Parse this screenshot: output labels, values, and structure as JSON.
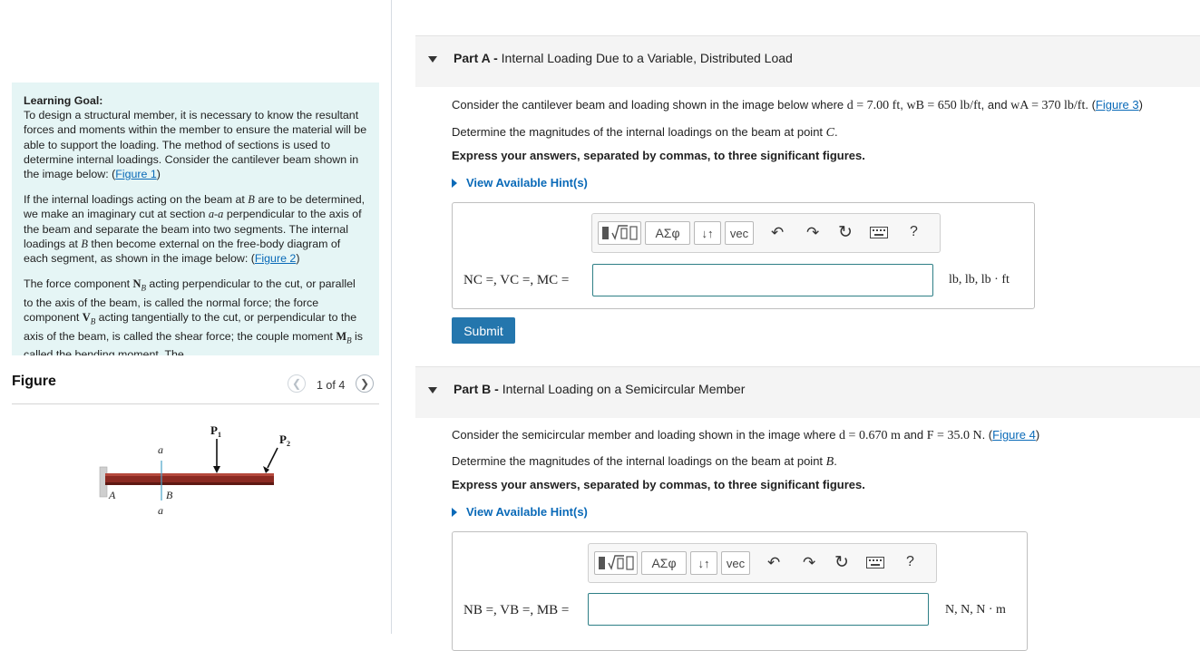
{
  "learning_goal": {
    "heading": "Learning Goal:",
    "p1_text": "To design a structural member, it is necessary to know the resultant forces and moments within the member to ensure the material will be able to support the loading. The method of sections is used to determine internal loadings. Consider the cantilever beam shown in the image below: (",
    "p1_link": "Figure 1",
    "p1_end": ")",
    "p2_a": "If the internal loadings acting on the beam at ",
    "p2_b_var": "B",
    "p2_c": " are to be determined, we make an imaginary cut at section ",
    "p2_d_var": "a-a",
    "p2_e": " perpendicular to the axis of the beam and separate the beam into two segments. The internal loadings at ",
    "p2_f_var": "B",
    "p2_g": " then become external on the free-body diagram of each segment, as shown in the image below: (",
    "p2_link": "Figure 2",
    "p2_end": ")",
    "p3_a": "The force component ",
    "p3_b_var": "N",
    "p3_b_sub": "B",
    "p3_c": " acting perpendicular to the cut, or parallel to the axis of the beam, is called the normal force; the force component ",
    "p3_d_var": "V",
    "p3_d_sub": "B",
    "p3_e": " acting tangentially to the cut, or perpendicular to the axis of the beam, is called the shear force; the couple moment ",
    "p3_f_var": "M",
    "p3_f_sub": "B",
    "p3_g": " is called the bending moment. The"
  },
  "figure_panel": {
    "title": "Figure",
    "counter": "1 of 4",
    "prev_icon": "chevron-left-icon",
    "next_icon": "chevron-right-icon",
    "labels": {
      "p1": "P",
      "p1_sub": "1",
      "p2": "P",
      "p2_sub": "2",
      "a_top": "a",
      "a_bottom": "a",
      "A": "A",
      "B": "B"
    },
    "colors": {
      "beam": "#8b2a22",
      "cut_line": "#4aa3c8",
      "wall": "#c8c8c8"
    }
  },
  "part_a": {
    "label": "Part A -",
    "title": "Internal Loading Due to a Variable, Distributed Load",
    "q1_a": "Consider the cantilever beam and loading shown in the image below where ",
    "q1_d": "d = 7.00 ft",
    "q1_sep1": ", ",
    "q1_wb": "wB = 650 lb/ft",
    "q1_sep2": ", and ",
    "q1_wa": "wA = 370 lb/ft",
    "q1_end": ". (",
    "q1_link": "Figure 3",
    "q1_close": ")",
    "q2_a": "Determine the magnitudes of the internal loadings on the beam at point ",
    "q2_var": "C",
    "q2_end": ".",
    "instruction": "Express your answers, separated by commas, to three significant figures.",
    "hint": "View Available Hint(s)",
    "eq_label": "NC =, VC =, MC =",
    "units": "lb, lb, lb · ft",
    "submit": "Submit"
  },
  "part_b": {
    "label": "Part B -",
    "title": "Internal Loading on a Semicircular Member",
    "q1_a": "Consider the semicircular member and loading shown in the image where ",
    "q1_d": "d = 0.670 m",
    "q1_sep": " and ",
    "q1_f": "F = 35.0 N",
    "q1_end": ". (",
    "q1_link": "Figure 4",
    "q1_close": ")",
    "q2_a": "Determine the magnitudes of the internal loadings on the beam at point ",
    "q2_var": "B",
    "q2_end": ".",
    "instruction": "Express your answers, separated by commas, to three significant figures.",
    "hint": "View Available Hint(s)",
    "eq_label": "NB =, VB =, MB =",
    "units": "N, N, N · m"
  },
  "toolbar": {
    "greek": "ΑΣφ",
    "arrows": "↓↑",
    "vec": "vec",
    "help": "?",
    "icons": [
      "templates-icon",
      "undo-icon",
      "redo-icon",
      "reset-icon",
      "keyboard-icon",
      "help-icon"
    ]
  }
}
